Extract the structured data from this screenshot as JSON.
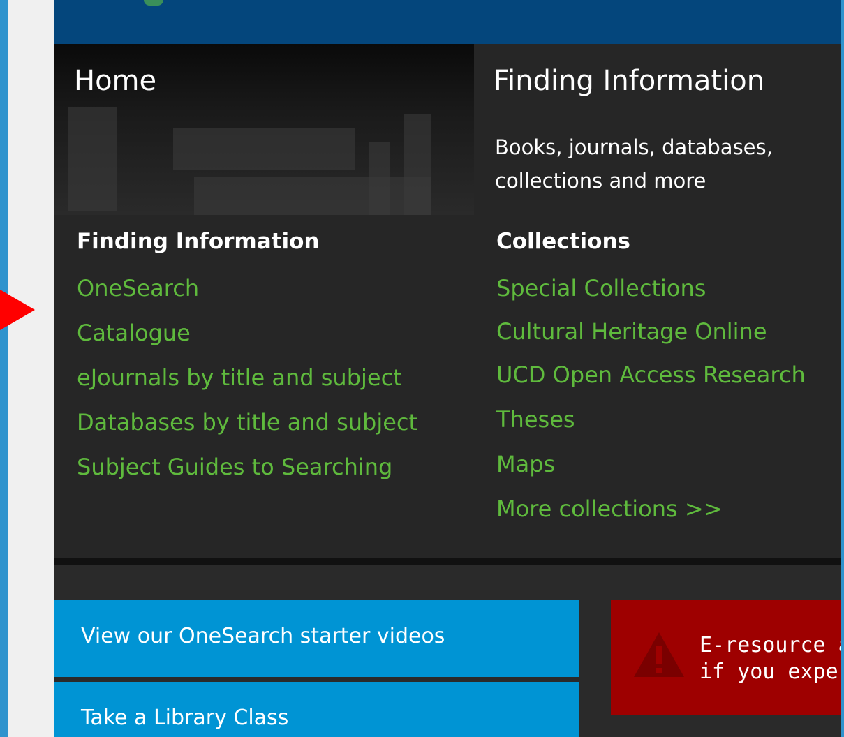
{
  "hero": {
    "title": "Home"
  },
  "finding_panel": {
    "title": "Finding Information",
    "subtitle": "Books, journals, databases, collections and more"
  },
  "menu": {
    "left": {
      "heading": "Finding Information",
      "links": [
        "OneSearch",
        "Catalogue",
        "eJournals by title and subject",
        "Databases by title and subject",
        "Subject Guides to Searching"
      ]
    },
    "right": {
      "heading": "Collections",
      "links": [
        "Special Collections",
        "Cultural Heritage Online",
        "UCD Open Access Research",
        "Theses",
        "Maps",
        "More collections >>"
      ]
    }
  },
  "promos": [
    "View our OneSearch starter videos",
    "Take a Library Class"
  ],
  "alert": {
    "icon": "warning-icon",
    "line1": "E-resource a",
    "line2": "if you exper"
  },
  "colors": {
    "link": "#5fba3d",
    "topbar": "#04467c",
    "promo": "#0094d4",
    "alert": "#9e0000",
    "arrow": "#ff0000"
  }
}
